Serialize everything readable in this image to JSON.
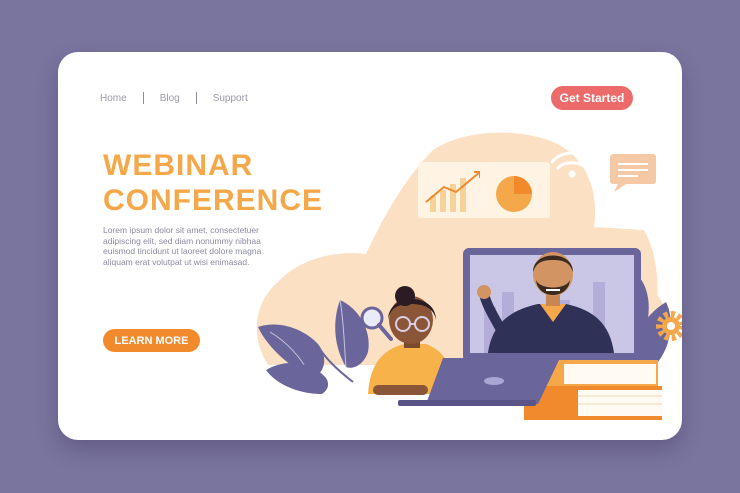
{
  "nav": {
    "items": [
      {
        "label": "Home"
      },
      {
        "label": "Blog"
      },
      {
        "label": "Support"
      }
    ]
  },
  "header": {
    "cta_label": "Get Started"
  },
  "hero": {
    "title_line1": "WEBINAR",
    "title_line2": "CONFERENCE",
    "description": "Lorem ipsum dolor sit amet, consectetuer adipiscing elit, sed diam nonummy nibhaa euismod tincidunt ut laoreet dolore magna aliquam erat volutpat ut wisi enimasad.",
    "button_label": "LEARN MORE"
  },
  "colors": {
    "background": "#7a759e",
    "card": "#ffffff",
    "title": "#f4a84a",
    "cta": "#ec6a6a",
    "learn_more": "#f08a2c",
    "accent_peach": "#fbe0c4",
    "accent_purple": "#6a659a"
  },
  "illustration": {
    "icons": [
      "wifi-icon",
      "chat-bubble-icon",
      "gear-icon",
      "magnifier-icon",
      "line-chart-icon",
      "pie-chart-icon"
    ]
  }
}
